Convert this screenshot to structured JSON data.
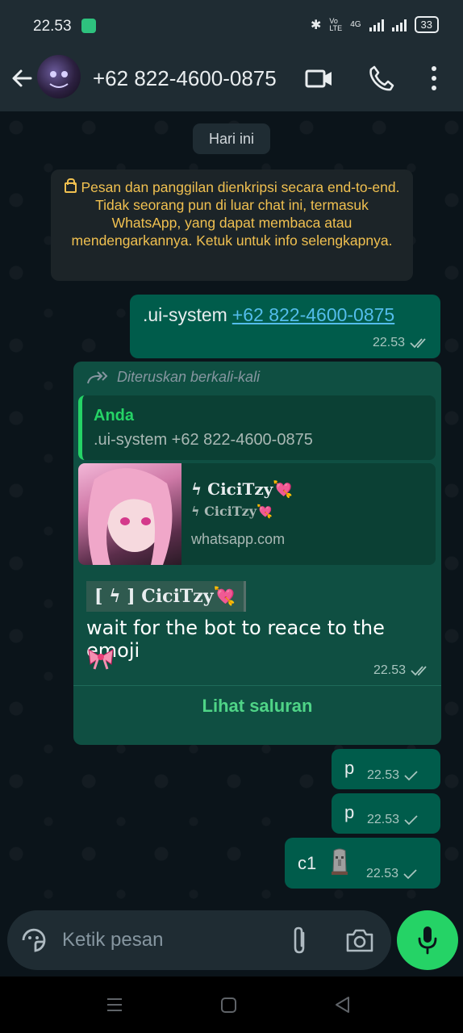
{
  "status_bar": {
    "time": "22.53",
    "network_type": "4G",
    "battery": "33"
  },
  "header": {
    "contact_name": "+62 822-4600-0875"
  },
  "date_chip": "Hari ini",
  "encryption_notice": "Pesan dan panggilan dienkripsi secara end-to-end. Tidak seorang pun di luar chat ini, termasuk WhatsApp, yang dapat membaca atau mendengarkannya. Ketuk untuk info selengkapnya.",
  "messages": [
    {
      "type": "outgoing",
      "text": ".ui-system",
      "link": "+62 822-4600-0875",
      "time": "22.53",
      "status": "read"
    },
    {
      "type": "outgoing-forwarded",
      "forwarded_label": "Diteruskan berkali-kali",
      "quote_name": "Anda",
      "quote_text": ".ui-system +62 822-4600-0875",
      "preview_title": "ϟ CiciTzy",
      "preview_subtitle": "ϟ CiciTzy",
      "preview_site": "whatsapp.com",
      "tagline": "[ ϟ ] CiciTzy",
      "body": "wait for the bot to reace to the emoji",
      "body_emoji": "bow-emoji",
      "time": "22.53",
      "status": "read",
      "cta": "Lihat saluran"
    },
    {
      "type": "outgoing",
      "text": "p",
      "time": "22.53",
      "status": "sent"
    },
    {
      "type": "outgoing",
      "text": "p",
      "time": "22.53",
      "status": "sent"
    },
    {
      "type": "outgoing",
      "text": "c1",
      "emoji": "moai-emoji",
      "time": "22.53",
      "status": "sent"
    }
  ],
  "composer": {
    "placeholder": "Ketik pesan"
  },
  "colors": {
    "bubble_out": "#005c4b",
    "accent_green": "#25d366",
    "link_blue": "#53bdeb",
    "notice_yellow": "#f0c050",
    "app_bar": "#1f2c33"
  },
  "icons": [
    "back-arrow-icon",
    "video-call-icon",
    "voice-call-icon",
    "menu-dots-icon",
    "forward-icon",
    "double-check-icon",
    "single-check-icon",
    "sticker-icon",
    "attach-icon",
    "camera-icon",
    "mic-icon",
    "lock-icon"
  ]
}
